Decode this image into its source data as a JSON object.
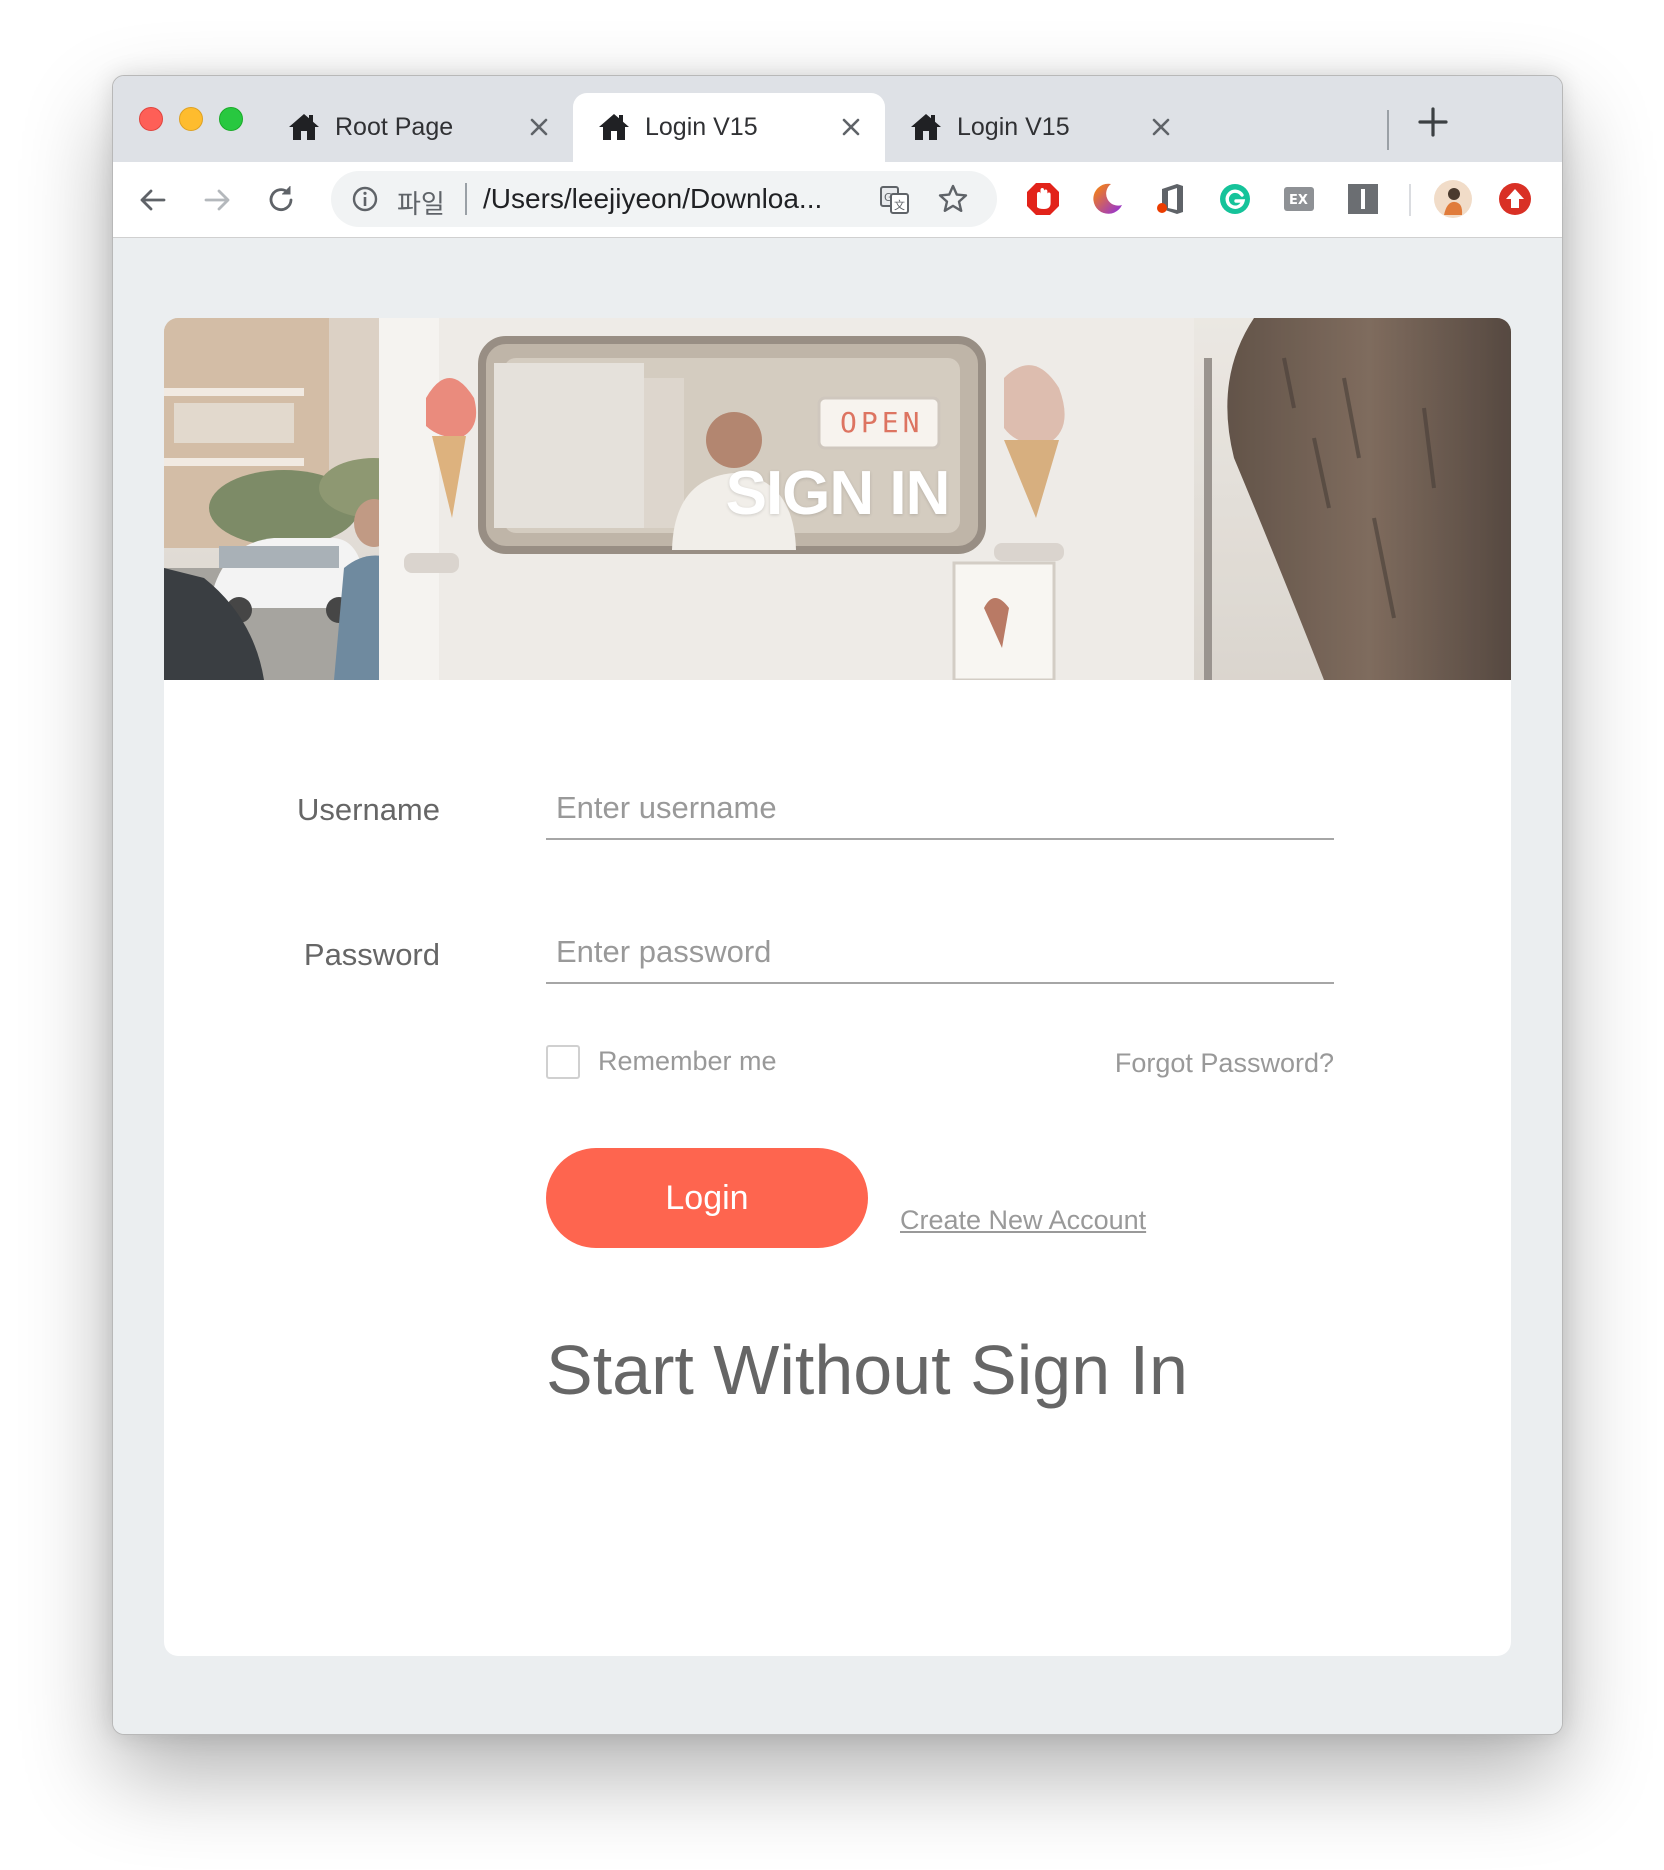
{
  "browser": {
    "tabs": [
      {
        "title": "Root Page",
        "icon": "home-icon",
        "active": false
      },
      {
        "title": "Login V15",
        "icon": "home-icon",
        "active": true
      },
      {
        "title": "Login V15",
        "icon": "home-icon",
        "active": false
      }
    ],
    "address": {
      "scheme_label": "파일",
      "url": "/Users/leejiyeon/Downloa..."
    },
    "extensions": [
      "adblock-icon",
      "moon-icon",
      "office-icon",
      "grammarly-icon",
      "ex-icon",
      "instapaper-icon"
    ],
    "profile_icon": "avatar-icon",
    "update_icon": "update-arrow-icon"
  },
  "hero": {
    "title": "SIGN IN",
    "sign_text": "OPEN"
  },
  "form": {
    "username_label": "Username",
    "username_placeholder": "Enter username",
    "username_value": "",
    "password_label": "Password",
    "password_placeholder": "Enter password",
    "password_value": "",
    "remember_label": "Remember me",
    "remember_checked": false,
    "forgot_label": "Forgot Password?",
    "login_label": "Login",
    "create_label": "Create New Account",
    "start_label": "Start Without Sign In"
  },
  "colors": {
    "accent": "#fe654f",
    "page_bg": "#ebeef0",
    "card_bg": "#ffffff",
    "label_text": "#666666",
    "muted_text": "#999999"
  }
}
